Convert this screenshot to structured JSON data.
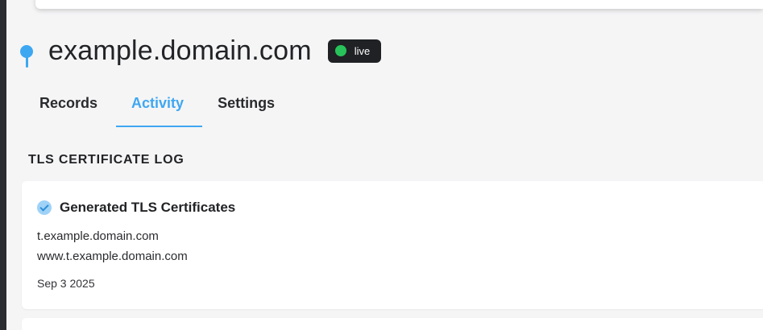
{
  "header": {
    "domain": "example.domain.com",
    "status_badge": "live"
  },
  "tabs": [
    {
      "label": "Records",
      "active": false
    },
    {
      "label": "Activity",
      "active": true
    },
    {
      "label": "Settings",
      "active": false
    }
  ],
  "section": {
    "title": "TLS CERTIFICATE LOG"
  },
  "log_entries": [
    {
      "title": "Generated TLS Certificates",
      "domains": [
        "t.example.domain.com",
        "www.t.example.domain.com"
      ],
      "date": "Sep 3 2025"
    }
  ],
  "colors": {
    "accent": "#3ea7f2",
    "live_dot": "#27c25a",
    "badge_bg": "#1f2124",
    "page_bg": "#f5f5f6"
  },
  "icons": {
    "pin": "pin-icon",
    "status": "status-dot-icon",
    "check": "check-circle-icon"
  }
}
